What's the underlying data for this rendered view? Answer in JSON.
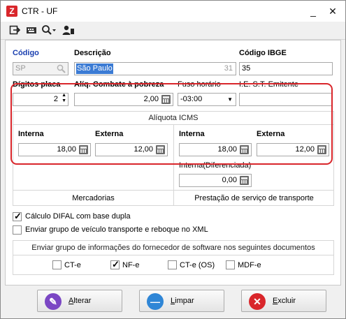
{
  "window": {
    "title": "CTR - UF",
    "app_icon": "Z"
  },
  "toolbar": {
    "tools": [
      "exit-icon",
      "keyboard-icon",
      "search-dropdown-icon",
      "user-icon"
    ]
  },
  "form": {
    "codigo_label": "Código",
    "codigo_value": "SP",
    "descricao_label": "Descrição",
    "descricao_value": "São Paulo",
    "descricao_maxlen": "31",
    "codigo_ibge_label": "Código IBGE",
    "codigo_ibge_value": "35",
    "digitos_placa_label": "Dígitos placa",
    "digitos_placa_value": "2",
    "aliq_combate_label": "Alíq. Combate à pobreza",
    "aliq_combate_value": "2,00",
    "fuso_label": "Fuso horário",
    "fuso_value": "-03:00",
    "ie_st_label": "I.E. S.T.  Emitente",
    "ie_st_value": ""
  },
  "icms": {
    "title": "Alíquota ICMS",
    "mercadorias": {
      "interna_label": "Interna",
      "interna_value": "18,00",
      "externa_label": "Externa",
      "externa_value": "12,00",
      "footer": "Mercadorias"
    },
    "transporte": {
      "interna_label": "Interna",
      "interna_value": "18,00",
      "externa_label": "Externa",
      "externa_value": "12,00",
      "diferenciada_label": "Interna(Diferenciada)",
      "diferenciada_value": "0,00",
      "footer": "Prestação de serviço de transporte"
    }
  },
  "options": {
    "difal_label": "Cálculo DIFAL com base dupla",
    "difal_checked": true,
    "veiculo_label": "Enviar grupo de veículo transporte e reboque no XML",
    "veiculo_checked": false
  },
  "documents": {
    "title": "Enviar grupo de informações do fornecedor de software nos seguintes documentos",
    "items": [
      {
        "label": "CT-e",
        "checked": false
      },
      {
        "label": "NF-e",
        "checked": true
      },
      {
        "label": "CT-e (OS)",
        "checked": false
      },
      {
        "label": "MDF-e",
        "checked": false
      }
    ]
  },
  "buttons": {
    "alterar_label": "Alterar",
    "alterar_underline": "A",
    "alterar_rest": "lterar",
    "limpar_label": "Limpar",
    "limpar_underline": "L",
    "limpar_rest": "impar",
    "excluir_label": "Excluir",
    "excluir_underline": "E",
    "excluir_rest": "xcluir"
  },
  "colors": {
    "accent_blue": "#1a3fb0",
    "highlight_red": "#d9262b",
    "selection": "#3b7bd4"
  }
}
